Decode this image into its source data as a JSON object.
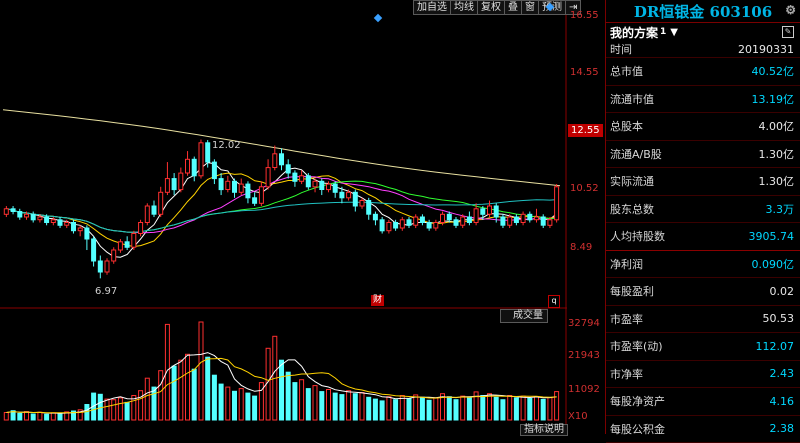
{
  "toolbar": [
    "加自选",
    "均线",
    "复权",
    "叠",
    "窗",
    "预测",
    "⇥"
  ],
  "price_axis": [
    "16.55",
    "14.55",
    "12.55",
    "10.52",
    "8.49"
  ],
  "volume_axis": [
    "32794",
    "21943",
    "11092",
    "X10"
  ],
  "chart_labels": {
    "high": "12.02",
    "low": "6.97",
    "cai": "财",
    "q": "q",
    "volume_btn": "成交量",
    "indicator_btn": "指标说明"
  },
  "chart_data": {
    "type": "candlestick",
    "price_range": [
      6.0,
      16.55
    ],
    "volume_range": [
      0,
      32794
    ],
    "high": 12.02,
    "low": 6.97,
    "candles": [
      [
        9.3,
        9.5,
        9.6,
        9.2
      ],
      [
        9.5,
        9.4,
        9.6,
        9.3
      ],
      [
        9.4,
        9.2,
        9.5,
        9.1
      ],
      [
        9.2,
        9.3,
        9.4,
        9.1
      ],
      [
        9.3,
        9.1,
        9.4,
        9.0
      ],
      [
        9.1,
        9.2,
        9.3,
        9.0
      ],
      [
        9.2,
        9.0,
        9.3,
        8.9
      ],
      [
        9.0,
        9.1,
        9.2,
        8.9
      ],
      [
        9.1,
        8.9,
        9.2,
        8.8
      ],
      [
        8.9,
        9.0,
        9.1,
        8.8
      ],
      [
        9.0,
        8.7,
        9.1,
        8.6
      ],
      [
        8.7,
        8.8,
        8.9,
        8.5
      ],
      [
        8.8,
        8.4,
        8.9,
        8.0
      ],
      [
        8.4,
        7.6,
        8.5,
        7.4
      ],
      [
        7.6,
        7.2,
        7.8,
        6.97
      ],
      [
        7.2,
        7.6,
        7.7,
        7.1
      ],
      [
        7.6,
        8.0,
        8.1,
        7.5
      ],
      [
        8.0,
        8.3,
        8.4,
        7.9
      ],
      [
        8.3,
        8.1,
        8.5,
        8.0
      ],
      [
        8.1,
        8.6,
        8.7,
        8.0
      ],
      [
        8.6,
        9.0,
        9.1,
        8.5
      ],
      [
        9.0,
        9.6,
        9.7,
        8.9
      ],
      [
        9.6,
        9.3,
        9.8,
        9.2
      ],
      [
        9.3,
        10.1,
        10.3,
        9.2
      ],
      [
        10.1,
        10.6,
        11.2,
        10.0
      ],
      [
        10.6,
        10.2,
        10.8,
        10.0
      ],
      [
        10.2,
        10.8,
        11.0,
        10.1
      ],
      [
        10.8,
        11.3,
        11.6,
        10.7
      ],
      [
        11.3,
        10.7,
        11.4,
        10.5
      ],
      [
        10.7,
        11.9,
        12.02,
        10.6
      ],
      [
        11.9,
        11.2,
        12.0,
        11.0
      ],
      [
        11.2,
        10.6,
        11.3,
        10.4
      ],
      [
        10.6,
        10.2,
        10.8,
        10.0
      ],
      [
        10.2,
        10.5,
        10.7,
        10.1
      ],
      [
        10.5,
        10.1,
        10.6,
        9.9
      ],
      [
        10.1,
        10.4,
        10.6,
        10.0
      ],
      [
        10.4,
        9.9,
        10.5,
        9.7
      ],
      [
        9.9,
        9.7,
        10.1,
        9.6
      ],
      [
        9.7,
        10.3,
        10.5,
        9.6
      ],
      [
        10.3,
        11.0,
        11.3,
        10.2
      ],
      [
        11.0,
        11.5,
        11.8,
        10.9
      ],
      [
        11.5,
        11.1,
        11.7,
        10.9
      ],
      [
        11.1,
        10.8,
        11.3,
        10.6
      ],
      [
        10.8,
        10.5,
        10.9,
        10.3
      ],
      [
        10.5,
        10.7,
        10.9,
        10.4
      ],
      [
        10.7,
        10.3,
        10.8,
        10.2
      ],
      [
        10.3,
        10.5,
        10.6,
        10.1
      ],
      [
        10.5,
        10.2,
        10.6,
        10.0
      ],
      [
        10.2,
        10.4,
        10.5,
        10.1
      ],
      [
        10.4,
        10.1,
        10.5,
        9.9
      ],
      [
        10.1,
        9.9,
        10.3,
        9.7
      ],
      [
        9.9,
        10.1,
        10.2,
        9.8
      ],
      [
        10.1,
        9.6,
        10.2,
        9.4
      ],
      [
        9.6,
        9.8,
        9.9,
        9.5
      ],
      [
        9.8,
        9.3,
        9.9,
        9.1
      ],
      [
        9.3,
        9.1,
        9.4,
        8.9
      ],
      [
        9.1,
        8.7,
        9.2,
        8.6
      ],
      [
        8.7,
        9.0,
        9.1,
        8.6
      ],
      [
        9.0,
        8.8,
        9.1,
        8.7
      ],
      [
        8.8,
        9.1,
        9.2,
        8.7
      ],
      [
        9.1,
        8.9,
        9.2,
        8.8
      ],
      [
        8.9,
        9.2,
        9.3,
        8.8
      ],
      [
        9.2,
        9.0,
        9.3,
        8.9
      ],
      [
        9.0,
        8.8,
        9.1,
        8.7
      ],
      [
        8.8,
        9.0,
        9.1,
        8.7
      ],
      [
        9.0,
        9.3,
        9.4,
        8.9
      ],
      [
        9.3,
        9.1,
        9.4,
        9.0
      ],
      [
        9.1,
        8.9,
        9.2,
        8.8
      ],
      [
        8.9,
        9.2,
        9.3,
        8.8
      ],
      [
        9.2,
        9.0,
        9.4,
        8.9
      ],
      [
        9.0,
        9.5,
        9.7,
        8.9
      ],
      [
        9.5,
        9.3,
        9.6,
        9.1
      ],
      [
        9.3,
        9.6,
        9.8,
        9.2
      ],
      [
        9.6,
        9.2,
        9.7,
        9.0
      ],
      [
        9.2,
        8.9,
        9.3,
        8.8
      ],
      [
        8.9,
        9.2,
        9.3,
        8.8
      ],
      [
        9.2,
        9.0,
        9.3,
        8.9
      ],
      [
        9.0,
        9.3,
        9.4,
        8.9
      ],
      [
        9.3,
        9.1,
        9.4,
        9.0
      ],
      [
        9.1,
        9.2,
        9.5,
        9.0
      ],
      [
        9.2,
        8.9,
        9.3,
        8.8
      ],
      [
        8.9,
        9.1,
        9.2,
        8.8
      ],
      [
        9.1,
        10.3,
        10.4,
        9.0
      ]
    ],
    "volumes": [
      2500,
      3100,
      2200,
      2800,
      2000,
      2600,
      1900,
      2400,
      2100,
      2700,
      3000,
      3400,
      5200,
      9000,
      8600,
      7000,
      6800,
      7400,
      5900,
      8200,
      9800,
      14000,
      11000,
      16500,
      32000,
      18000,
      20000,
      22000,
      17000,
      32794,
      21000,
      15000,
      12000,
      11000,
      9600,
      10500,
      9000,
      8000,
      12500,
      24000,
      28000,
      20000,
      16000,
      12500,
      13500,
      10500,
      11500,
      9500,
      10200,
      9000,
      8500,
      9800,
      8800,
      9200,
      7600,
      7000,
      6400,
      7800,
      6800,
      8200,
      7200,
      8400,
      7600,
      6600,
      7400,
      8800,
      7800,
      6800,
      8000,
      7600,
      9400,
      8200,
      8800,
      7600,
      6800,
      8200,
      7400,
      8000,
      7200,
      7800,
      6900,
      7500,
      9500
    ],
    "up_color": "#ff3030",
    "down_color": "#54ffff"
  },
  "panel": {
    "title": "DR恒银金 603106",
    "scheme": "我的方案",
    "scheme_num": "1",
    "rows": [
      {
        "label": "时间",
        "value": "20190331",
        "cyan": false
      },
      {
        "label": "总市值",
        "value": "40.52亿",
        "cyan": true
      },
      {
        "label": "流通市值",
        "value": "13.19亿",
        "cyan": true
      },
      {
        "label": "总股本",
        "value": "4.00亿",
        "cyan": false
      },
      {
        "label": "流通A/B股",
        "value": "1.30亿",
        "cyan": false
      },
      {
        "label": "实际流通",
        "value": "1.30亿",
        "cyan": false
      },
      {
        "label": "股东总数",
        "value": "3.3万",
        "cyan": true
      },
      {
        "label": "人均持股数",
        "value": "3905.74",
        "cyan": true
      },
      {
        "label": "净利润",
        "value": "0.090亿",
        "cyan": true
      },
      {
        "label": "每股盈利",
        "value": "0.02",
        "cyan": false
      },
      {
        "label": "市盈率",
        "value": "50.53",
        "cyan": false
      },
      {
        "label": "市盈率(动)",
        "value": "112.07",
        "cyan": true
      },
      {
        "label": "市净率",
        "value": "2.43",
        "cyan": true
      },
      {
        "label": "每股净资产",
        "value": "4.16",
        "cyan": true
      },
      {
        "label": "每股公积金",
        "value": "2.38",
        "cyan": true
      }
    ]
  }
}
